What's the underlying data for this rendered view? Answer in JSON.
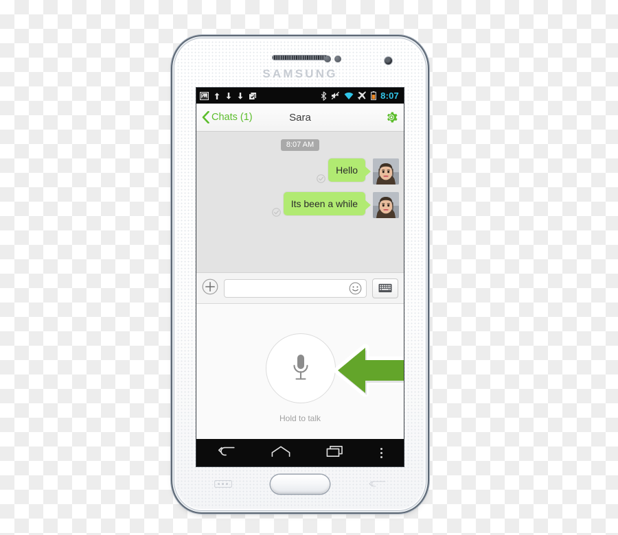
{
  "scene": {
    "device_brand": "SAMSUNG",
    "background": "transparent-checkerboard"
  },
  "statusbar": {
    "time": "8:07",
    "time_color": "#31c5e8",
    "left_icons": [
      {
        "name": "screenshot-image-icon",
        "glyph": "image"
      },
      {
        "name": "upload-arrow-icon",
        "glyph": "up-arrow"
      },
      {
        "name": "download-arrow-icon",
        "glyph": "down-arrow"
      },
      {
        "name": "download-arrow-2-icon",
        "glyph": "down-arrow"
      },
      {
        "name": "clipboard-check-icon",
        "glyph": "clipboard"
      }
    ],
    "right_icons": [
      {
        "name": "bluetooth-icon",
        "glyph": "bluetooth"
      },
      {
        "name": "mute-vibrate-icon",
        "glyph": "speaker-muted"
      },
      {
        "name": "wifi-icon",
        "glyph": "wifi",
        "color": "#31c5e8"
      },
      {
        "name": "airplane-mode-icon",
        "glyph": "airplane"
      },
      {
        "name": "battery-icon",
        "glyph": "battery",
        "color": "#f08a24"
      }
    ]
  },
  "header": {
    "back_label": "Chats (1)",
    "title": "Sara",
    "accent_color": "#5bbd2b",
    "settings_icon": "gear-icon"
  },
  "chat": {
    "timestamp": "8:07 AM",
    "bubble_color": "#b1ea72",
    "messages": [
      {
        "text": "Hello",
        "status": "sent",
        "avatar": "sara-avatar"
      },
      {
        "text": "Its been a while",
        "status": "sent",
        "avatar": "sara-avatar"
      }
    ]
  },
  "input_bar": {
    "attach_label": "+",
    "field_value": "",
    "field_placeholder": "",
    "emoji_icon": "smiley-icon",
    "keyboard_icon": "keyboard-icon"
  },
  "voice_panel": {
    "mic_icon": "microphone-icon",
    "hold_label": "Hold to talk",
    "annotation_arrow_color": "#63a52a"
  },
  "navbar": {
    "items": [
      {
        "name": "nav-back-button",
        "icon": "back-arrow-icon"
      },
      {
        "name": "nav-home-button",
        "icon": "home-icon"
      },
      {
        "name": "nav-recents-button",
        "icon": "recents-icon"
      },
      {
        "name": "nav-menu-button",
        "icon": "overflow-dots-icon"
      }
    ]
  }
}
